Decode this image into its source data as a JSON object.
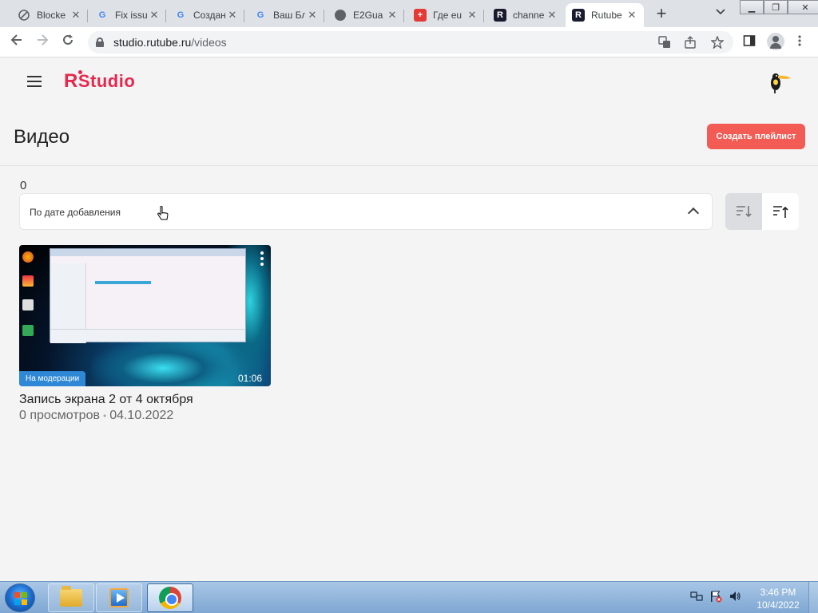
{
  "browser": {
    "tabs": [
      {
        "title": "Blocke",
        "favicon": "blocked-page-icon"
      },
      {
        "title": "Fix issu",
        "favicon": "google-icon"
      },
      {
        "title": "Создан",
        "favicon": "google-icon"
      },
      {
        "title": "Ваш Бл",
        "favicon": "google-icon"
      },
      {
        "title": "E2Gua",
        "favicon": "globe-icon"
      },
      {
        "title": "Где eu",
        "favicon": "swiss-flag-icon"
      },
      {
        "title": "channe",
        "favicon": "rutube-icon"
      },
      {
        "title": "Rutube",
        "favicon": "rutube-icon",
        "active": true
      }
    ],
    "url_host": "studio.rutube.ru",
    "url_path": "/videos"
  },
  "header": {
    "logo_r": "R",
    "logo_text": "Studio",
    "brand_color": "#e5284c"
  },
  "main": {
    "title": "Видео",
    "create_playlist_label": "Создать плейлист",
    "accent_color": "#f25c54",
    "video_count": "0",
    "sort": {
      "selected": "По дате добавления"
    }
  },
  "videos": [
    {
      "title": "Запись экрана 2 от 4 октября",
      "views": "0 просмотров",
      "date": "04.10.2022",
      "status_badge": "На модерации",
      "duration": "01:06"
    }
  ],
  "taskbar": {
    "time": "3:46 PM",
    "date": "10/4/2022"
  }
}
